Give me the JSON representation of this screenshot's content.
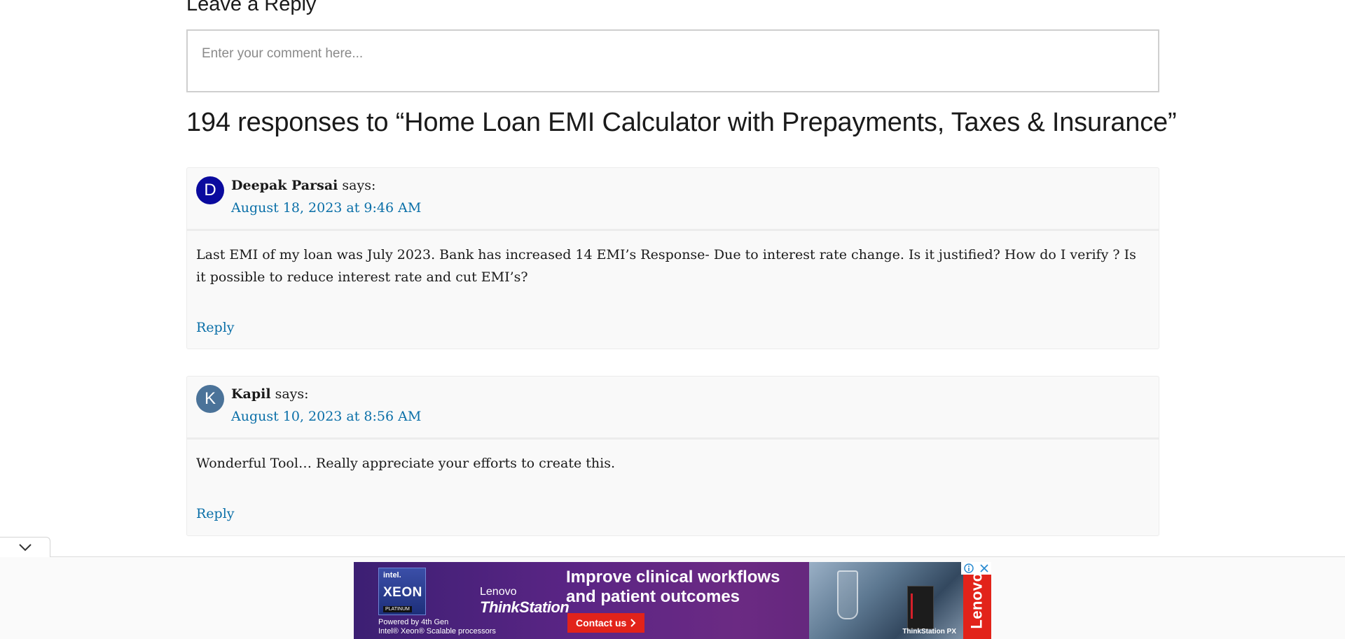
{
  "reply_section": {
    "heading": "Leave a Reply",
    "comment_placeholder": "Enter your comment here..."
  },
  "responses_title": "194 responses to “Home Loan EMI Calculator with Prepayments, Taxes & Insurance”",
  "comments": [
    {
      "avatar_letter": "D",
      "avatar_color": "#0a0a9e",
      "author": "Deepak Parsai",
      "says": "says:",
      "date": "August 18, 2023 at 9:46 AM",
      "body": "Last EMI of my loan was July 2023. Bank has increased 14 EMI’s Response- Due to interest rate change. Is it justified? How do I verify ? Is it possible to reduce interest rate and cut EMI’s?",
      "reply_label": "Reply"
    },
    {
      "avatar_letter": "K",
      "avatar_color": "#4b7399",
      "author": "Kapil",
      "says": "says:",
      "date": "August 10, 2023 at 8:56 AM",
      "body": "Wonderful Tool… Really appreciate your efforts to create this.",
      "reply_label": "Reply"
    }
  ],
  "ad": {
    "intel_label": "intel.",
    "xeon_label": "XEON",
    "platinum_label": "PLATINUM",
    "powered_line1": "Powered by 4th Gen",
    "powered_line2": "Intel® Xeon® Scalable processors",
    "lenovo_small": "Lenovo",
    "thinkstation": "ThinkStation",
    "headline_line1": "Improve clinical workflows",
    "headline_line2": "and patient outcomes",
    "cta_label": "Contact us",
    "product_label": "ThinkStation PX",
    "brand": "Lenovo",
    "brand_color": "#e2231a",
    "adchoices_icon": "info-icon",
    "close_icon": "close-icon"
  },
  "collapse_icon": "chevron-down-icon"
}
